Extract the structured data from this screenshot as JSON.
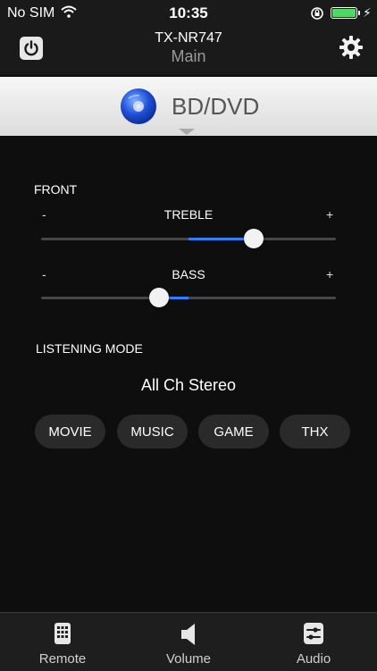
{
  "status_bar": {
    "carrier": "No SIM",
    "time": "10:35"
  },
  "header": {
    "model": "TX-NR747",
    "zone": "Main"
  },
  "source": {
    "label": "BD/DVD"
  },
  "front": {
    "section_label": "FRONT",
    "minus": "-",
    "plus": "+",
    "treble": {
      "label": "TREBLE",
      "level_fraction": 0.72
    },
    "bass": {
      "label": "BASS",
      "level_fraction": 0.4
    }
  },
  "listening_mode": {
    "section_label": "LISTENING MODE",
    "current": "All Ch Stereo",
    "buttons": [
      {
        "label": "MOVIE"
      },
      {
        "label": "MUSIC"
      },
      {
        "label": "GAME"
      },
      {
        "label": "THX"
      }
    ]
  },
  "tabs": [
    {
      "label": "Remote",
      "icon": "remote-icon"
    },
    {
      "label": "Volume",
      "icon": "speaker-icon"
    },
    {
      "label": "Audio",
      "icon": "sliders-icon"
    }
  ],
  "colors": {
    "accent": "#2f80ff",
    "battery": "#4cd964"
  }
}
